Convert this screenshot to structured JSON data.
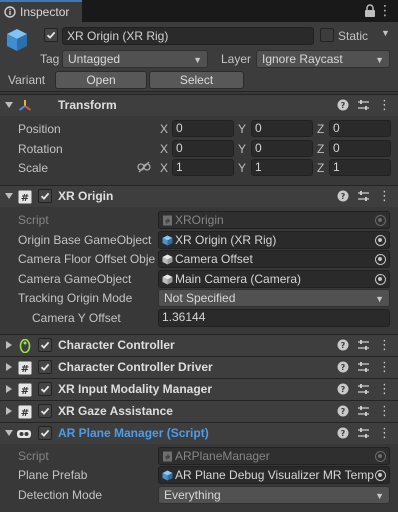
{
  "tab": {
    "label": "Inspector"
  },
  "gameobject": {
    "name": "XR Origin (XR Rig)",
    "static_label": "Static",
    "tag_label": "Tag",
    "tag_value": "Untagged",
    "layer_label": "Layer",
    "layer_value": "Ignore Raycast",
    "variant_label": "Variant",
    "open_label": "Open",
    "select_label": "Select"
  },
  "transform": {
    "title": "Transform",
    "rows": [
      {
        "label": "Position",
        "x": "0",
        "y": "0",
        "z": "0"
      },
      {
        "label": "Rotation",
        "x": "0",
        "y": "0",
        "z": "0"
      },
      {
        "label": "Scale",
        "x": "1",
        "y": "1",
        "z": "1"
      }
    ],
    "axes": {
      "x": "X",
      "y": "Y",
      "z": "Z"
    }
  },
  "xr_origin": {
    "title": "XR Origin",
    "script_label": "Script",
    "script_value": "XROrigin",
    "origin_base_label": "Origin Base GameObject",
    "origin_base_value": "XR Origin (XR Rig)",
    "camera_floor_label": "Camera Floor Offset Obje",
    "camera_floor_value": "Camera Offset",
    "camera_go_label": "Camera GameObject",
    "camera_go_value": "Main Camera (Camera)",
    "tracking_mode_label": "Tracking Origin Mode",
    "tracking_mode_value": "Not Specified",
    "camera_y_label": "Camera Y Offset",
    "camera_y_value": "1.36144"
  },
  "components": [
    {
      "title": "Character Controller"
    },
    {
      "title": "Character Controller Driver"
    },
    {
      "title": "XR Input Modality Manager"
    },
    {
      "title": "XR Gaze Assistance"
    }
  ],
  "ar_plane_manager": {
    "title": "AR Plane Manager (Script)",
    "script_label": "Script",
    "script_value": "ARPlaneManager",
    "plane_prefab_label": "Plane Prefab",
    "plane_prefab_value": "AR Plane Debug Visualizer MR Temp",
    "detection_mode_label": "Detection Mode",
    "detection_mode_value": "Everything"
  },
  "colors": {
    "accent": "#3a79bb",
    "selected_title": "#4e9ce8",
    "background": "#383838"
  }
}
